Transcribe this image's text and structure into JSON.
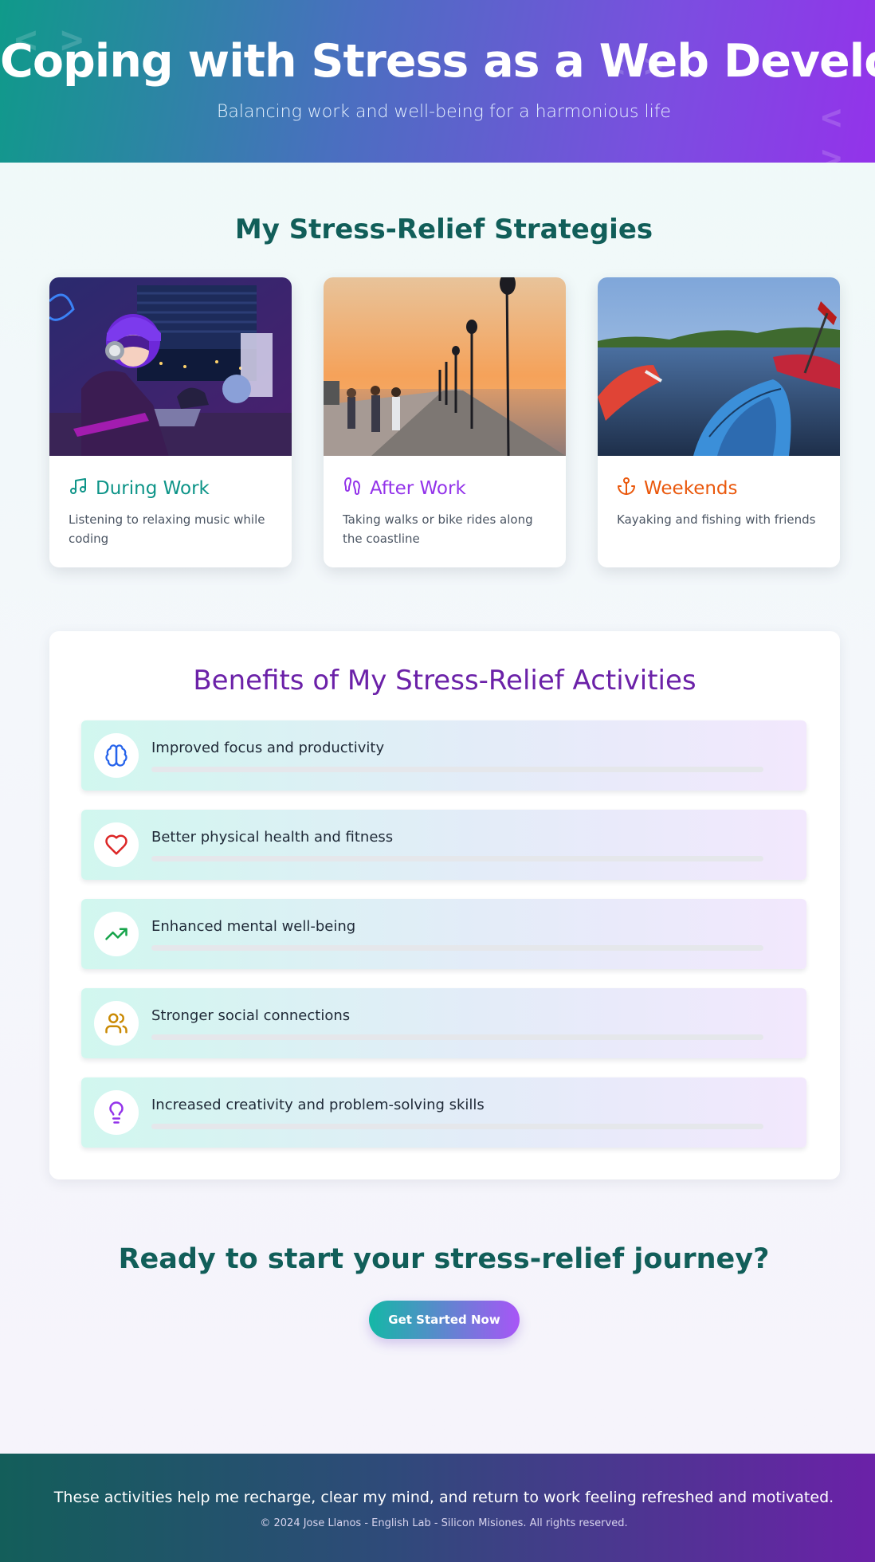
{
  "hero": {
    "title": "Coping with Stress as a Web Developer",
    "subtitle": "Balancing work and well-being for a harmonious life",
    "decor": [
      "< >",
      "< >",
      "< >"
    ]
  },
  "strategies": {
    "title": "My Stress-Relief Strategies",
    "cards": [
      {
        "title": "During Work",
        "description": "Listening to relaxing music while coding",
        "icon": "music-note-icon",
        "color": "#0d9488"
      },
      {
        "title": "After Work",
        "description": "Taking walks or bike rides along the coastline",
        "icon": "footprints-icon",
        "color": "#9333ea"
      },
      {
        "title": "Weekends",
        "description": "Kayaking and fishing with friends",
        "icon": "anchor-icon",
        "color": "#ea580c"
      }
    ]
  },
  "benefits": {
    "title": "Benefits of My Stress-Relief Activities",
    "items": [
      {
        "text": "Improved focus and productivity",
        "icon": "brain-icon",
        "color": "#2563eb"
      },
      {
        "text": "Better physical health and fitness",
        "icon": "heart-icon",
        "color": "#dc2626"
      },
      {
        "text": "Enhanced mental well-being",
        "icon": "trending-up-icon",
        "color": "#16a34a"
      },
      {
        "text": "Stronger social connections",
        "icon": "users-icon",
        "color": "#ca8a04"
      },
      {
        "text": "Increased creativity and problem-solving skills",
        "icon": "lightbulb-icon",
        "color": "#9333ea"
      }
    ]
  },
  "cta": {
    "title": "Ready to start your stress-relief journey?",
    "button": "Get Started Now"
  },
  "footer": {
    "message": "These activities help me recharge, clear my mind, and return to work feeling refreshed and motivated.",
    "copyright": "© 2024 Jose Llanos - English Lab - Silicon Misiones. All rights reserved."
  }
}
